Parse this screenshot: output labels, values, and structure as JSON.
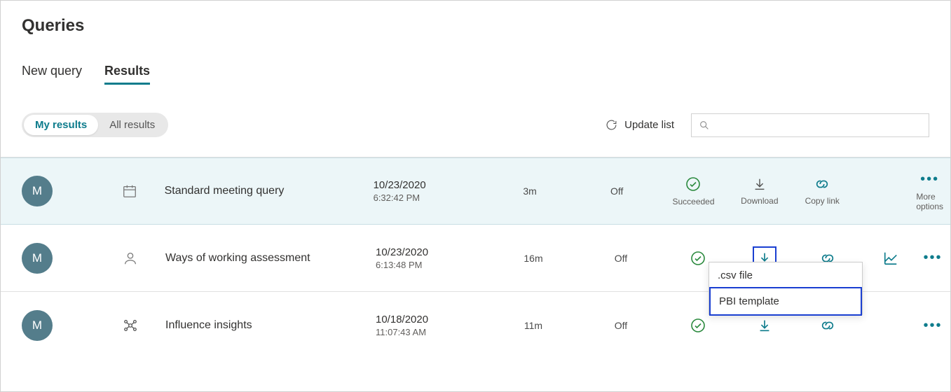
{
  "page_title": "Queries",
  "tabs": {
    "new_query": "New query",
    "results": "Results"
  },
  "filters": {
    "my_results": "My results",
    "all_results": "All results"
  },
  "toolbar": {
    "update_list": "Update list",
    "search_placeholder": ""
  },
  "action_labels": {
    "succeeded": "Succeeded",
    "download": "Download",
    "copy_link": "Copy link",
    "more_options": "More options"
  },
  "download_menu": {
    "csv": ".csv file",
    "pbi": "PBI template"
  },
  "rows": [
    {
      "avatar": "M",
      "name": "Standard meeting query",
      "date": "10/23/2020",
      "time": "6:32:42 PM",
      "duration": "3m",
      "auto": "Off"
    },
    {
      "avatar": "M",
      "name": "Ways of working assessment",
      "date": "10/23/2020",
      "time": "6:13:48 PM",
      "duration": "16m",
      "auto": "Off"
    },
    {
      "avatar": "M",
      "name": "Influence insights",
      "date": "10/18/2020",
      "time": "11:07:43 AM",
      "duration": "11m",
      "auto": "Off"
    }
  ]
}
